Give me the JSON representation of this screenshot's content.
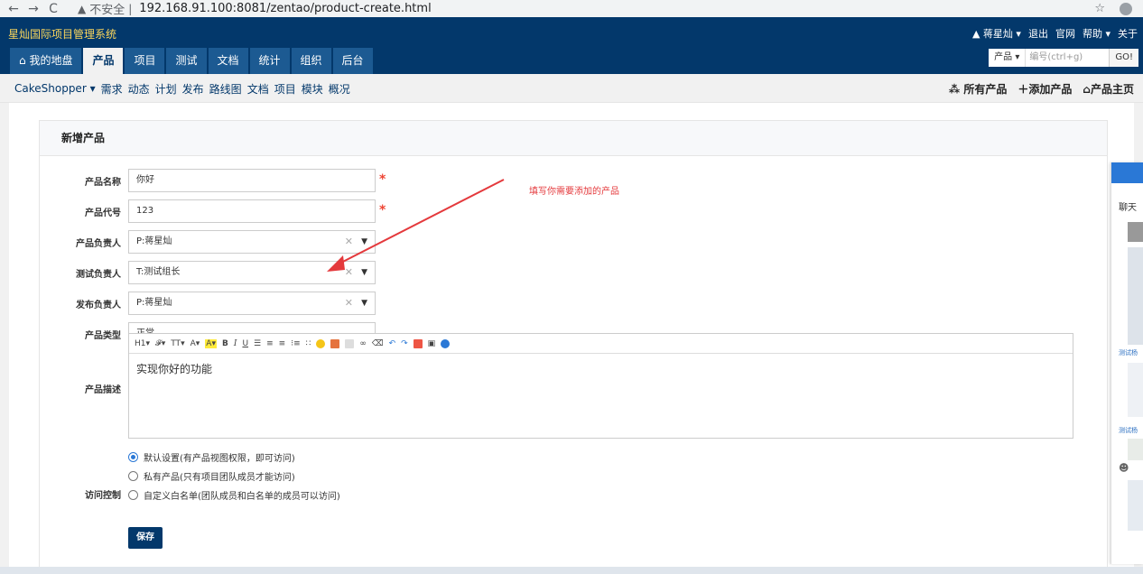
{
  "browser": {
    "back": "←",
    "forward": "→",
    "reload": "C",
    "insecure_label": "不安全",
    "url": "192.168.91.100:8081/zentao/product-create.html",
    "star": "☆"
  },
  "header": {
    "brand": "星灿国际项目管理系统",
    "user": "蒋星灿",
    "logout": "退出",
    "official": "官网",
    "help": "帮助",
    "about": "关于",
    "tabs": [
      "我的地盘",
      "产品",
      "项目",
      "测试",
      "文档",
      "统计",
      "组织",
      "后台"
    ],
    "search": {
      "scope": "产品",
      "placeholder": "编号(ctrl+g)",
      "go": "GO!"
    }
  },
  "subnav": {
    "product": "CakeShopper",
    "items": [
      "需求",
      "动态",
      "计划",
      "发布",
      "路线图",
      "文档",
      "项目",
      "模块",
      "概况"
    ],
    "all_products": "所有产品",
    "add_product": "添加产品",
    "product_home": "产品主页"
  },
  "form": {
    "title": "新增产品",
    "name_label": "产品名称",
    "name_value": "你好",
    "code_label": "产品代号",
    "code_value": "123",
    "po_label": "产品负责人",
    "po_value": "P:蒋星灿",
    "qd_label": "测试负责人",
    "qd_value": "T:测试组长",
    "rd_label": "发布负责人",
    "rd_value": "P:蒋星灿",
    "type_label": "产品类型",
    "type_value": "正常",
    "desc_label": "产品描述",
    "desc_value": "实现你好的功能",
    "acl_label": "访问控制",
    "acl_options": [
      "默认设置(有产品视图权限，即可访问)",
      "私有产品(只有项目团队成员才能访问)",
      "自定义白名单(团队成员和白名单的成员可以访问)"
    ],
    "acl_selected": 0,
    "save": "保存"
  },
  "editor_toolbar": [
    "H1",
    "𝓕",
    "TT",
    "A",
    "A",
    "B",
    "I",
    "U"
  ],
  "annotation": "填写你需要添加的产品",
  "side_panel": {
    "chat": "聊天",
    "caption1": "测试杨",
    "caption2": "测试杨"
  },
  "colors": {
    "header_bg": "#03386b",
    "brand": "#fcd65c",
    "required": "#e43",
    "annotation": "#e4393c",
    "accent": "#2a78d6"
  }
}
